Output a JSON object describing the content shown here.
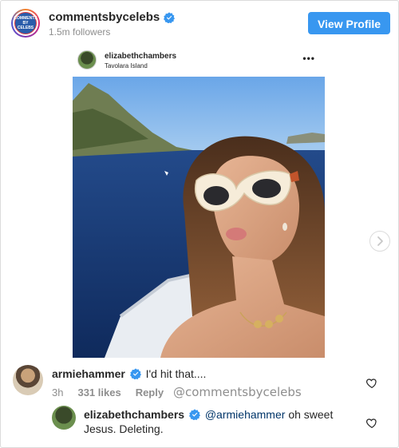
{
  "header": {
    "account_name": "commentsbycelebs",
    "followers": "1.5m followers",
    "view_profile_label": "View Profile",
    "avatar_text_line1": "COMMENTS",
    "avatar_text_line2": "BY CELEBS"
  },
  "post": {
    "username": "elizabethchambers",
    "location": "Tavolara Island",
    "more_glyph": "•••"
  },
  "comments": [
    {
      "username": "armiehammer",
      "text": "I'd hit that....",
      "time": "3h",
      "likes": "331 likes",
      "reply_label": "Reply",
      "watermark": "@commentsbycelebs"
    },
    {
      "username": "elizabethchambers",
      "mention": "@armiehammer",
      "text_line1": "oh sweet",
      "text_line2": "Jesus. Deleting."
    }
  ],
  "colors": {
    "button_blue": "#3897f0",
    "verified_blue": "#3897f0",
    "muted": "#8e8e8e",
    "text": "#262626",
    "mention": "#003569"
  },
  "icons": [
    "verified-badge-icon",
    "more-dots-icon",
    "chevron-right-icon",
    "heart-icon"
  ]
}
